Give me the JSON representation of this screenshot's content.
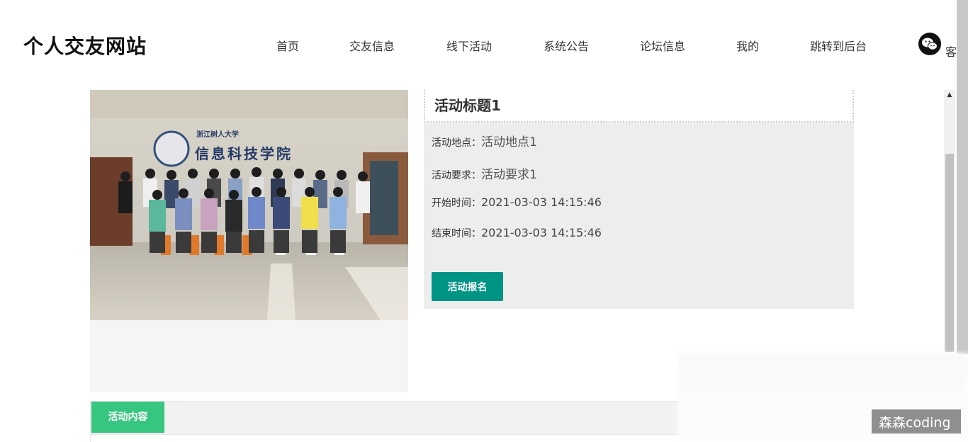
{
  "header": {
    "logo": "个人交友网站",
    "nav": [
      "首页",
      "交友信息",
      "线下活动",
      "系统公告",
      "论坛信息",
      "我的",
      "跳转到后台"
    ],
    "user_label": "客"
  },
  "activity": {
    "title": "活动标题1",
    "location_label": "活动地点：",
    "location": "活动地点1",
    "requirement_label": "活动要求：",
    "requirement": "活动要求1",
    "start_label": "开始时间：",
    "start": "2021-03-03 14:15:46",
    "end_label": "结束时间：",
    "end": "2021-03-03 14:15:46",
    "signup_button": "活动报名"
  },
  "photo": {
    "banner_line1": "浙江树人大学",
    "banner_line2": "信息科技学院"
  },
  "tabs": {
    "active": "活动内容"
  },
  "watermark": "森森coding",
  "colors": {
    "signup_button": "#009485",
    "active_tab": "#37c67f"
  }
}
